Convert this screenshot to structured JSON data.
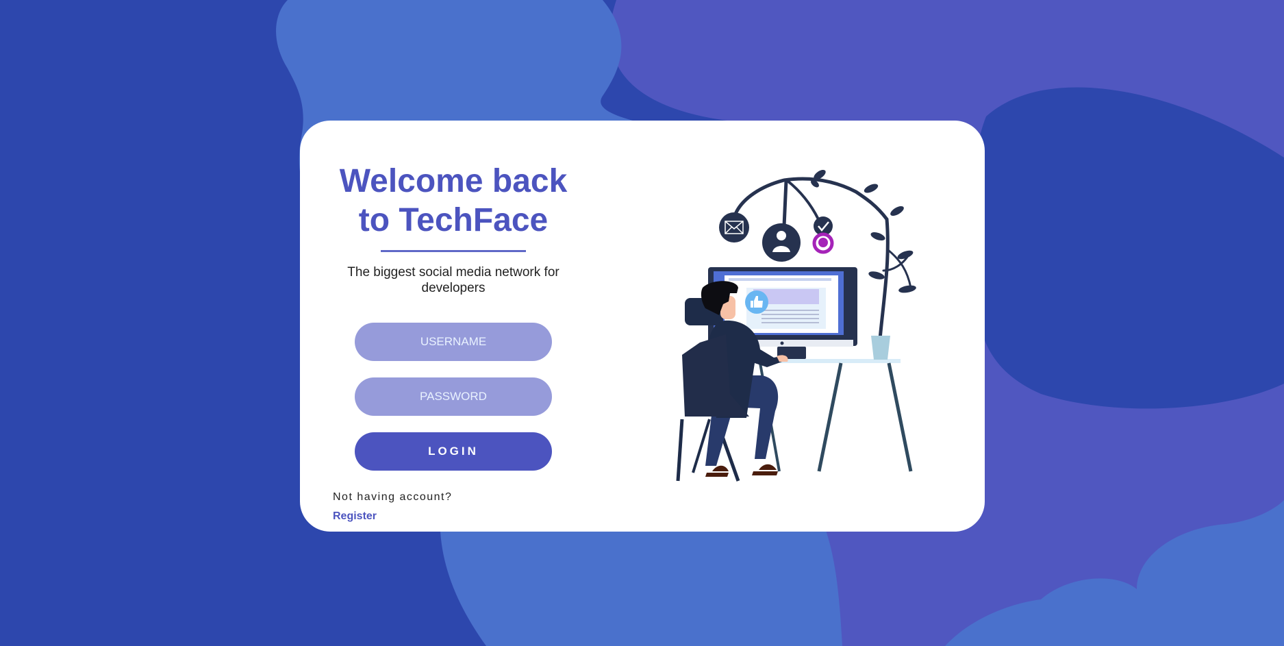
{
  "theme": {
    "background": "#2d47ad",
    "blob_light": "#4a71cc",
    "blob_violet": "#5057c0",
    "accent": "#4c54bf",
    "input_fill": "#969bda",
    "input_text": "#e9f2ff",
    "card": "#ffffff"
  },
  "login": {
    "title_line1": "Welcome back",
    "title_line2": "to TechFace",
    "subtitle": "The biggest social media network for developers",
    "username_placeholder": "USERNAME",
    "password_placeholder": "PASSWORD",
    "login_label": "LOGIN",
    "no_account_text": "Not having account?",
    "register_label": "Register"
  },
  "illustration": {
    "icons": [
      "mail-icon",
      "user-icon",
      "check-icon",
      "chat-icon",
      "thumbs-up-icon"
    ]
  }
}
